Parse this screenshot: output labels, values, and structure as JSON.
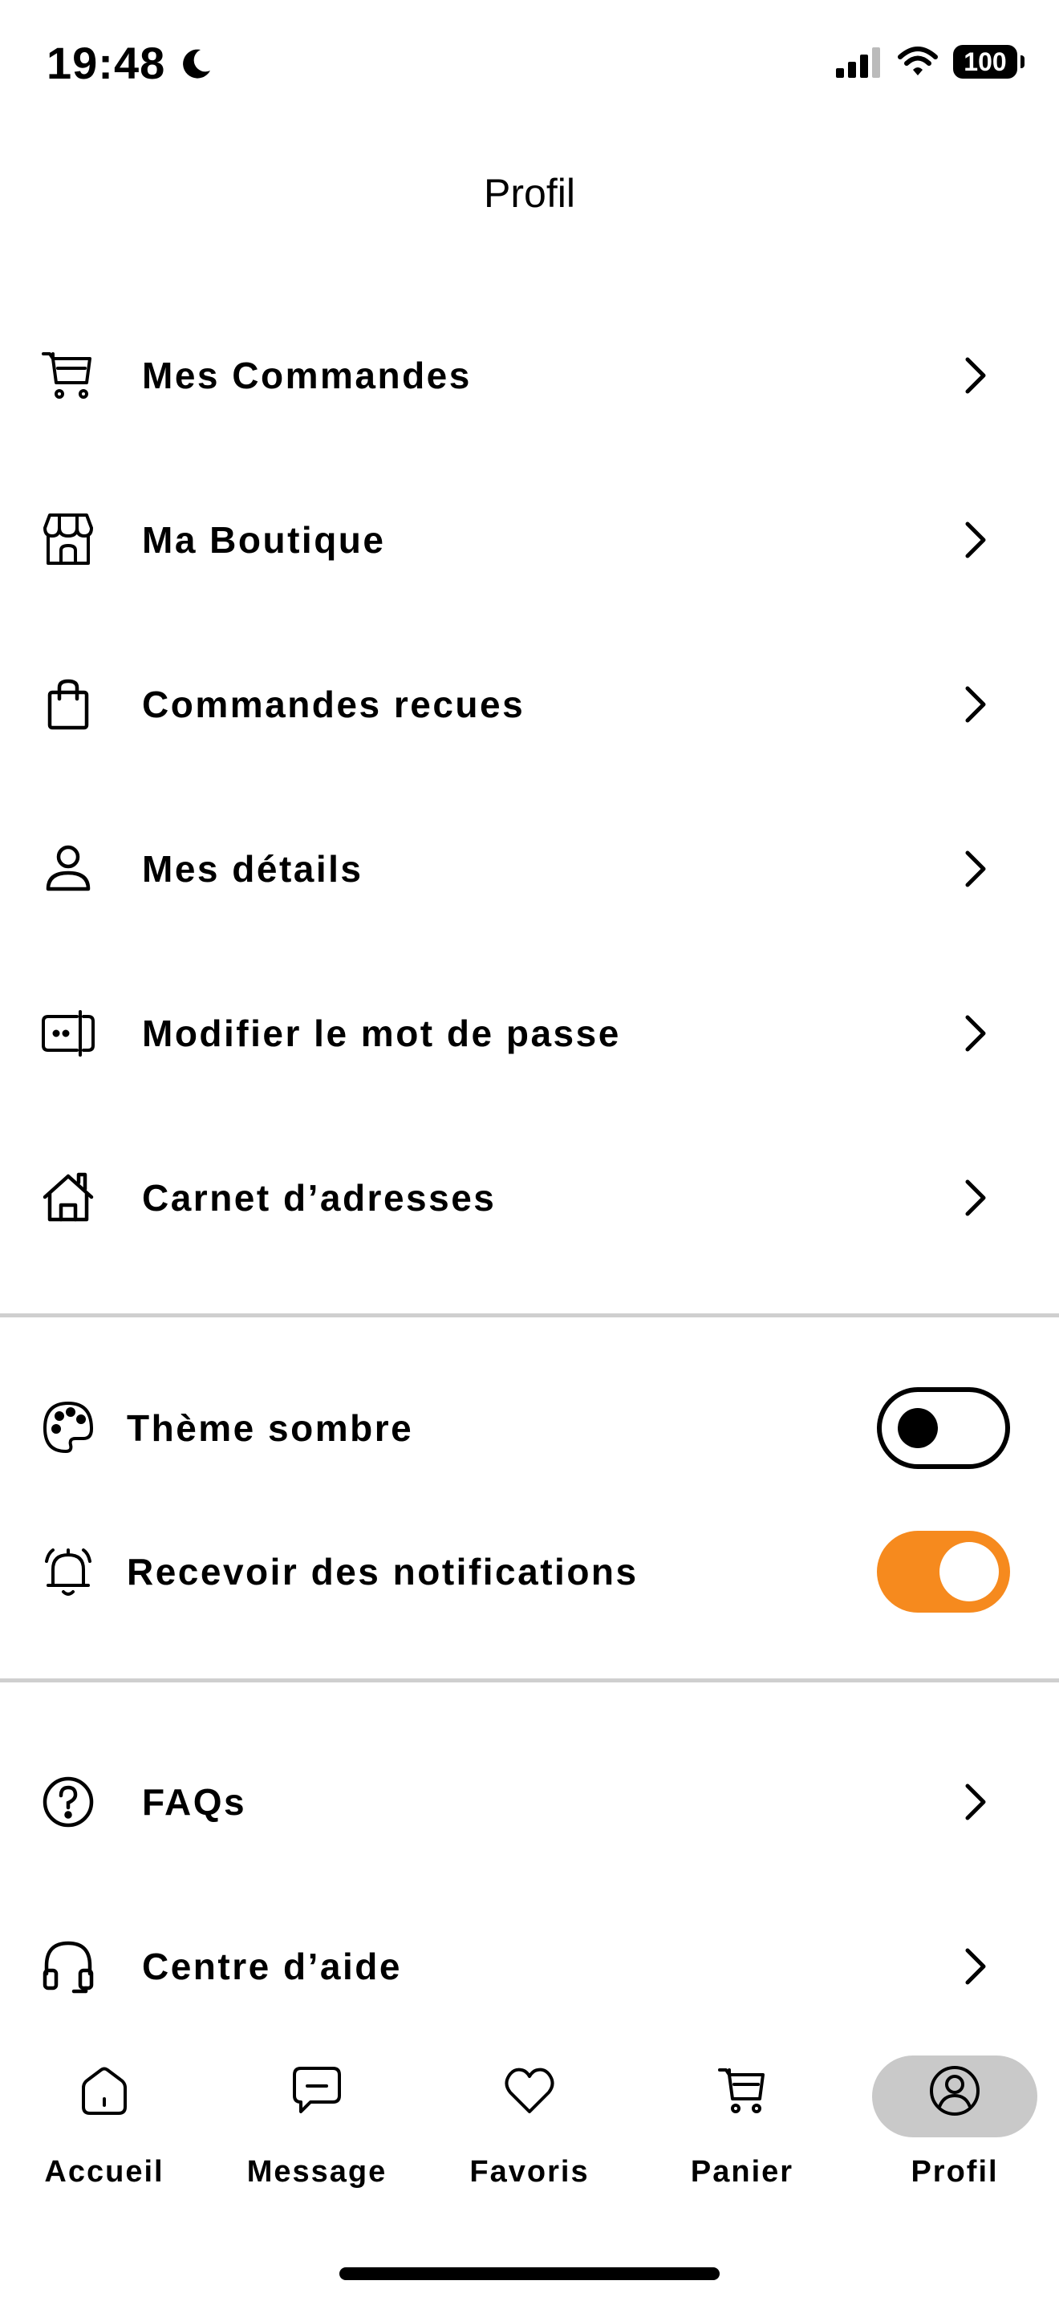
{
  "status_bar": {
    "time": "19:48",
    "battery": "100"
  },
  "header": {
    "title": "Profil"
  },
  "menu": [
    {
      "label": "Mes Commandes",
      "icon": "cart-icon"
    },
    {
      "label": "Ma Boutique",
      "icon": "store-icon"
    },
    {
      "label": "Commandes recues",
      "icon": "shopping-bag-icon"
    },
    {
      "label": "Mes détails",
      "icon": "user-icon"
    },
    {
      "label": "Modifier le mot de passe",
      "icon": "password-icon"
    },
    {
      "label": "Carnet d’adresses",
      "icon": "home-address-icon"
    }
  ],
  "settings": [
    {
      "label": "Thème sombre",
      "icon": "palette-icon",
      "enabled": false
    },
    {
      "label": "Recevoir des notifications",
      "icon": "bell-icon",
      "enabled": true
    }
  ],
  "support": [
    {
      "label": "FAQs",
      "icon": "question-icon"
    },
    {
      "label": "Centre d’aide",
      "icon": "headset-icon"
    }
  ],
  "tabs": [
    {
      "label": "Accueil",
      "icon": "home-icon",
      "active": false
    },
    {
      "label": "Message",
      "icon": "message-icon",
      "active": false
    },
    {
      "label": "Favoris",
      "icon": "heart-icon",
      "active": false
    },
    {
      "label": "Panier",
      "icon": "cart-icon",
      "active": false
    },
    {
      "label": "Profil",
      "icon": "profile-icon",
      "active": true
    }
  ],
  "colors": {
    "accent": "#f68a1e",
    "active_tab_bg": "#c9c9c9",
    "divider": "#cfcfcf"
  }
}
